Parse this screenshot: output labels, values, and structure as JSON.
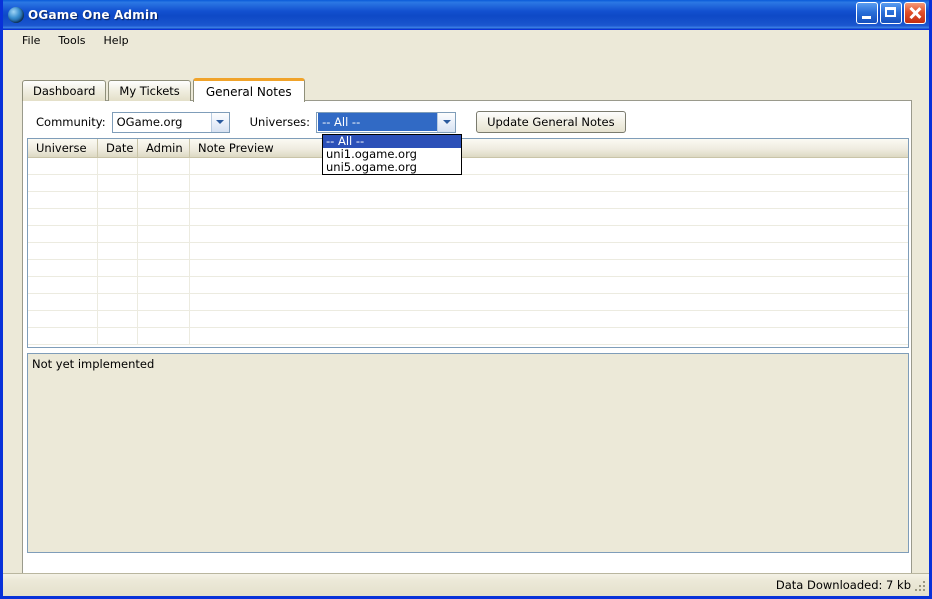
{
  "window": {
    "title": "OGame One Admin",
    "icon": "globe-icon",
    "controls": {
      "minimize": "minimize-icon",
      "maximize": "maximize-icon",
      "close": "close-icon"
    }
  },
  "menubar": {
    "items": [
      {
        "label": "File"
      },
      {
        "label": "Tools"
      },
      {
        "label": "Help"
      }
    ]
  },
  "tabs": [
    {
      "label": "Dashboard",
      "active": false
    },
    {
      "label": "My Tickets",
      "active": false
    },
    {
      "label": "General Notes",
      "active": true
    }
  ],
  "form": {
    "community_label": "Community:",
    "community_value": "OGame.org",
    "universes_label": "Universes:",
    "universes_value": "-- All --",
    "update_button": "Update General Notes",
    "dropdown_open": true,
    "dropdown_options": [
      {
        "label": "-- All --",
        "selected": true
      },
      {
        "label": "uni1.ogame.org",
        "selected": false
      },
      {
        "label": "uni5.ogame.org",
        "selected": false
      }
    ]
  },
  "table": {
    "columns": [
      "Universe",
      "Date",
      "Admin",
      "Note Preview"
    ],
    "rows": []
  },
  "notes": {
    "text": "Not yet implemented"
  },
  "statusbar": {
    "text": "Data Downloaded:  7 kb"
  },
  "colors": {
    "titlebar_blue": "#0e49c6",
    "window_border": "#0831d9",
    "face": "#ece9d8",
    "active_tab_accent": "#f0a32a",
    "selection_blue": "#2b50b8",
    "combo_selection": "#316ac5",
    "control_border": "#7f9db9"
  }
}
